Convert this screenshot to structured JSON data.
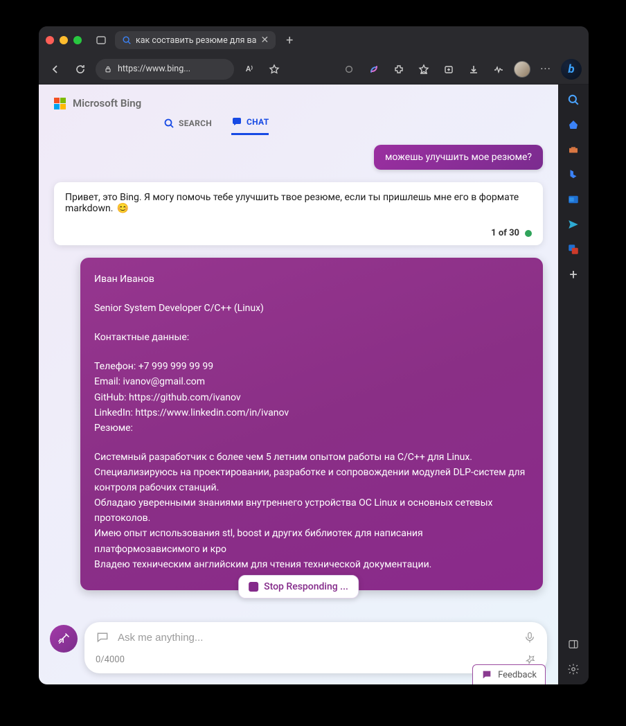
{
  "titlebar": {
    "tab_title": "как составить резюме для ва"
  },
  "toolbar": {
    "url": "https://www.bing..."
  },
  "header": {
    "brand": "Microsoft Bing",
    "tab_search": "SEARCH",
    "tab_chat": "CHAT"
  },
  "chat": {
    "user_msg1": "можешь улучшить мое резюме?",
    "assistant_msg": "Привет, это Bing. Я могу помочь тебе улучшить твое резюме, если ты пришлешь мне его в формате markdown.",
    "assistant_emoji": "😊",
    "counter": "1 of 30",
    "resume": {
      "name": "Иван Иванов",
      "title": "Senior System Developer C/C++ (Linux)",
      "contacts_heading": "Контактные данные:",
      "phone": "Телефон: +7 999 999 99 99",
      "email": "Email: ivanov@gmail.com",
      "github": "GitHub: https://github.com/ivanov",
      "linkedin": "LinkedIn: https://www.linkedin.com/in/ivanov",
      "resume_heading": "Резюме:",
      "p1": "Системный разработчик с более чем 5 летним опытом работы на C/C++ для Linux.",
      "p2": "Специализируюсь на проектировании, разработке и сопровождении модулей DLP-систем для контроля рабочих станций.",
      "p3": "Обладаю уверенными знаниями внутреннего устройства ОС Linux и основных сетевых протоколов.",
      "p4": "Имею опыт использования stl, boost и других библиотек для написания платформозависимого и кро",
      "p5": "Владею техническим английским для чтения технической документации."
    }
  },
  "stop_btn": "Stop Responding ...",
  "composer": {
    "placeholder": "Ask me anything...",
    "counter": "0/4000"
  },
  "feedback": "Feedback"
}
